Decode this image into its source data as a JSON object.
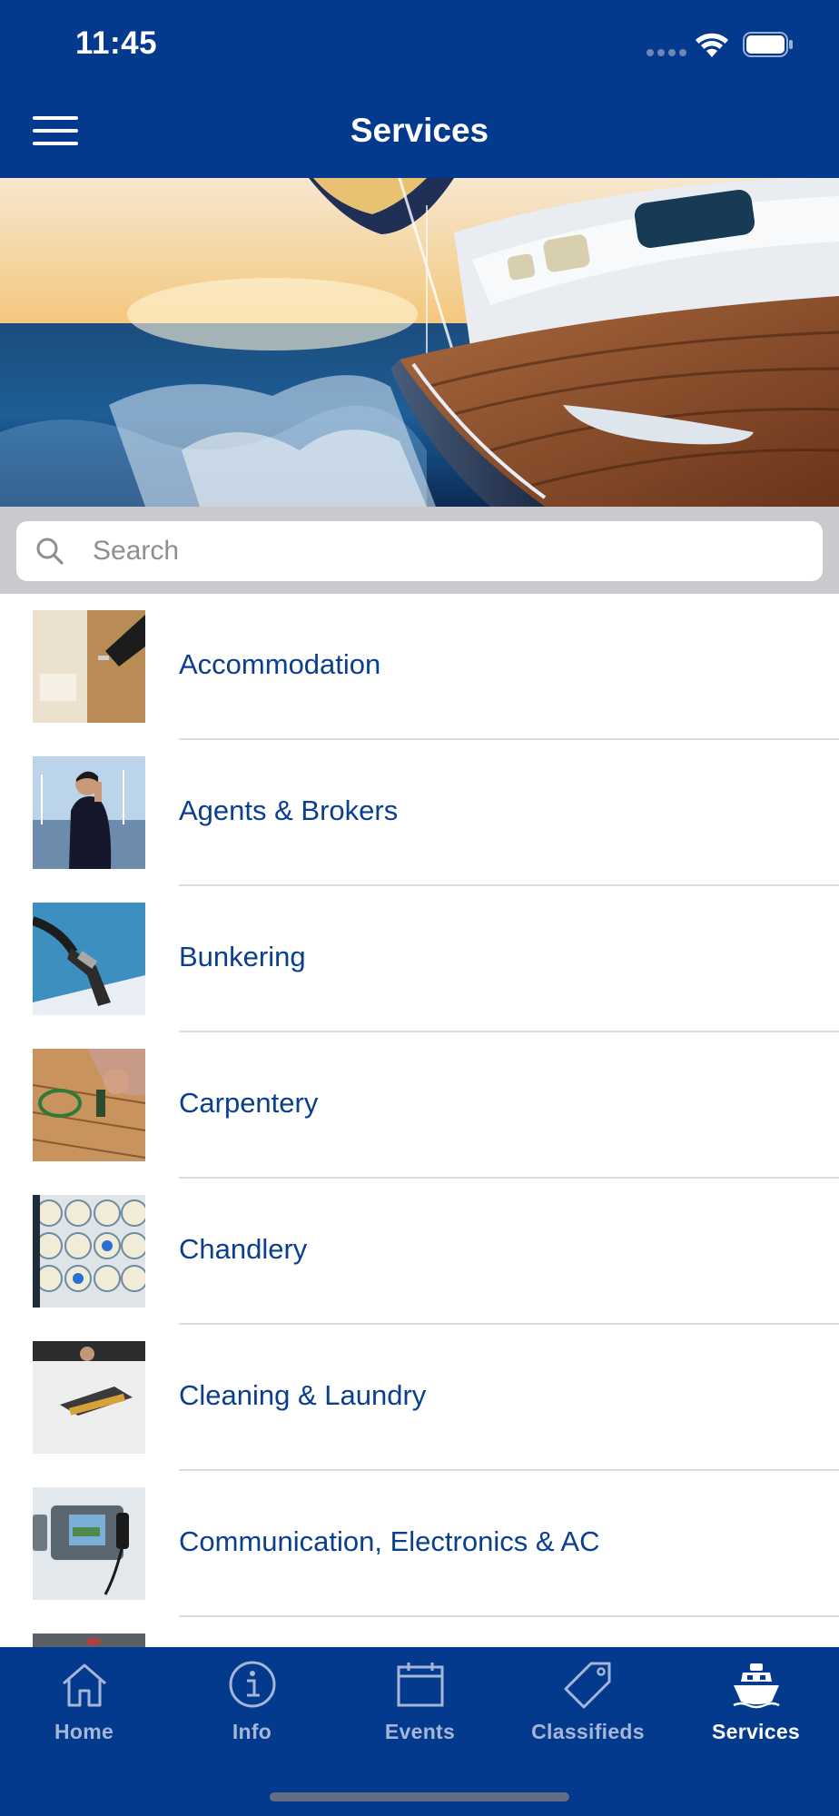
{
  "status_bar": {
    "time": "11:45"
  },
  "nav": {
    "title": "Services"
  },
  "search": {
    "placeholder": "Search",
    "value": ""
  },
  "services": [
    {
      "label": "Accommodation"
    },
    {
      "label": "Agents & Brokers"
    },
    {
      "label": "Bunkering"
    },
    {
      "label": "Carpentery"
    },
    {
      "label": "Chandlery"
    },
    {
      "label": "Cleaning & Laundry"
    },
    {
      "label": "Communication, Electronics & AC"
    }
  ],
  "tabs": [
    {
      "label": "Home",
      "icon": "house-icon"
    },
    {
      "label": "Info",
      "icon": "info-icon"
    },
    {
      "label": "Events",
      "icon": "calendar-icon"
    },
    {
      "label": "Classifieds",
      "icon": "tag-icon"
    },
    {
      "label": "Services",
      "icon": "boat-icon",
      "active": true
    }
  ],
  "colors": {
    "brand": "#033a8e",
    "link": "#0a3e8f",
    "tab_inactive": "#a6b6d6"
  }
}
